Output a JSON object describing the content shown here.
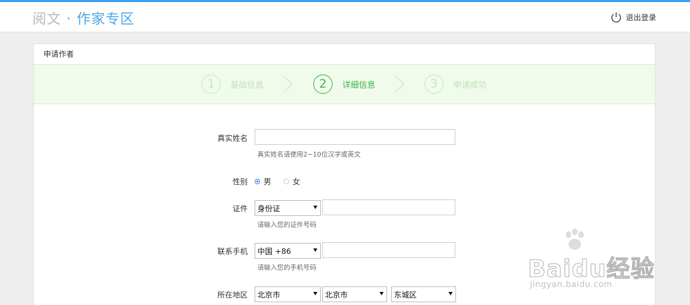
{
  "header": {
    "brand_part1": "阅文",
    "brand_sep": " · ",
    "brand_part2": "作家专区",
    "logout_label": "退出登录"
  },
  "panel": {
    "title": "申请作者"
  },
  "steps": [
    {
      "number": "1",
      "label": "基础信息",
      "state": "inactive"
    },
    {
      "number": "2",
      "label": "详细信息",
      "state": "active"
    },
    {
      "number": "3",
      "label": "申请成功",
      "state": "inactive"
    }
  ],
  "form": {
    "real_name": {
      "label": "真实姓名",
      "value": "",
      "hint": "真实姓名请使用2~10位汉字或英文"
    },
    "gender": {
      "label": "性别",
      "options": [
        "男",
        "女"
      ],
      "selected": "男"
    },
    "id_doc": {
      "label": "证件",
      "type_value": "身份证",
      "number_value": "",
      "hint": "请输入您的证件号码"
    },
    "phone": {
      "label": "联系手机",
      "country_value": "中国 +86",
      "number_value": "",
      "hint": "请输入您的手机号码"
    },
    "region": {
      "label": "所在地区",
      "province": "北京市",
      "city": "北京市",
      "district": "东城区"
    }
  },
  "watermark": {
    "brand": "Baidu经验",
    "url": "jingyan.baidu.com"
  },
  "colors": {
    "accent_blue": "#3a9ff0",
    "step_active": "#3cb54a",
    "step_bg": "#f0fbeb"
  }
}
